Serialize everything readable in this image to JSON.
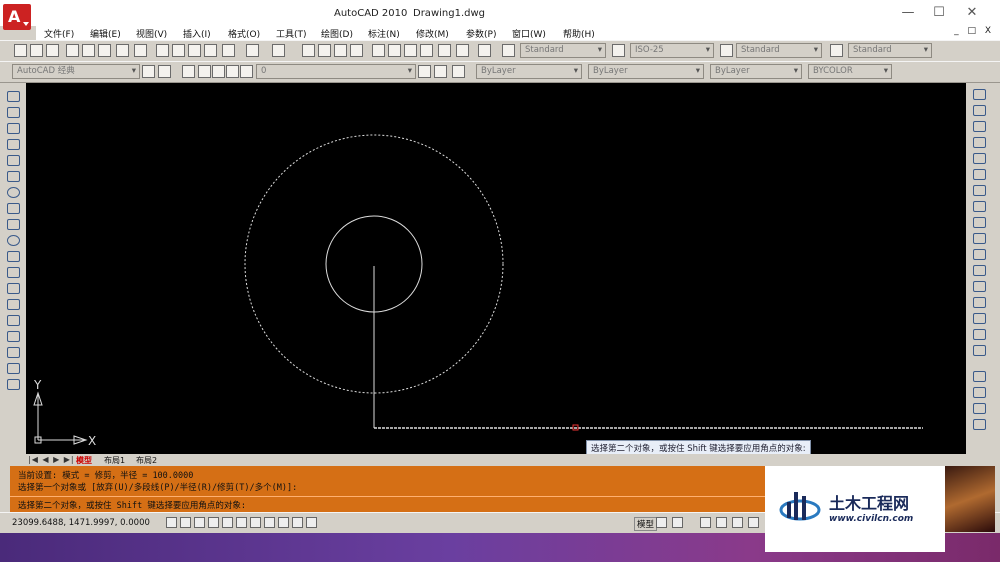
{
  "title": {
    "app": "AutoCAD 2010",
    "doc": "Drawing1.dwg"
  },
  "window_controls": {
    "minimize": "—",
    "maximize": "☐",
    "close": "✕"
  },
  "menu": [
    "文件(F)",
    "编辑(E)",
    "视图(V)",
    "插入(I)",
    "格式(O)",
    "工具(T)",
    "绘图(D)",
    "标注(N)",
    "修改(M)",
    "参数(P)",
    "窗口(W)",
    "帮助(H)"
  ],
  "menu_controls": "_ □ X",
  "styles": {
    "text": "Standard",
    "dim": "ISO-25",
    "table": "Standard",
    "multileader": "Standard"
  },
  "workspace": "AutoCAD 经典",
  "layer": "0",
  "properties": {
    "color": "ByLayer",
    "linetype": "ByLayer",
    "lineweight": "ByLayer",
    "plotstyle": "BYCOLOR"
  },
  "ucs": {
    "x": "X",
    "y": "Y"
  },
  "layout_tabs": [
    "模型",
    "布局1",
    "布局2"
  ],
  "tooltip": "选择第二个对象，或按住 Shift 键选择要应用角点的对象:",
  "command_lines": [
    "当前设置: 模式 = 修剪，半径 = 100.0000",
    "选择第一个对象或 [放弃(U)/多段线(P)/半径(R)/修剪(T)/多个(M)]:",
    "选择第二个对象，或按住 Shift 键选择要应用角点的对象:"
  ],
  "coordinates": "23099.6488, 1471.9997, 0.0000",
  "status_model": "模型",
  "watermark": {
    "title": "土木工程网",
    "url": "www.civilcn.com"
  },
  "colors": {
    "canvas": "#000000",
    "command_bg": "#d56f15",
    "title_red": "#c22222"
  }
}
